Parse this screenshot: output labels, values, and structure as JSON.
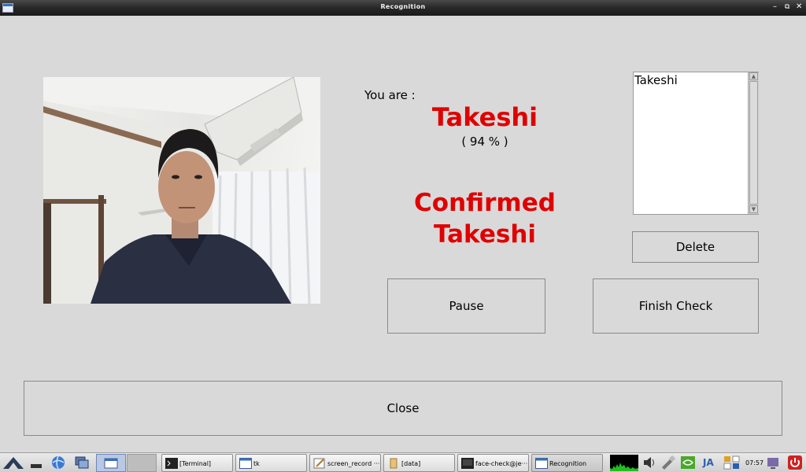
{
  "window": {
    "title": "Recognition"
  },
  "recognition": {
    "prompt": "You are :",
    "name": "Takeshi",
    "confidence": "( 94 % )",
    "confirmed_line1": "Confirmed",
    "confirmed_line2": "Takeshi"
  },
  "registered_list": {
    "items": [
      "Takeshi"
    ]
  },
  "buttons": {
    "delete": "Delete",
    "pause": "Pause",
    "finish_check": "Finish Check",
    "close": "Close"
  },
  "taskbar": {
    "tasks": [
      {
        "label": "[Terminal]",
        "icon": "terminal-icon"
      },
      {
        "label": "tk",
        "icon": "window-icon"
      },
      {
        "label": "screen_record ···",
        "icon": "editor-icon"
      },
      {
        "label": "[data]",
        "icon": "folder-icon"
      },
      {
        "label": "face-check@je···",
        "icon": "terminal-icon"
      },
      {
        "label": "Recognition",
        "icon": "window-icon"
      }
    ],
    "language": "JA",
    "clock": "07:57"
  },
  "colors": {
    "accent_red": "#e00000",
    "background": "#d9d9d9"
  }
}
